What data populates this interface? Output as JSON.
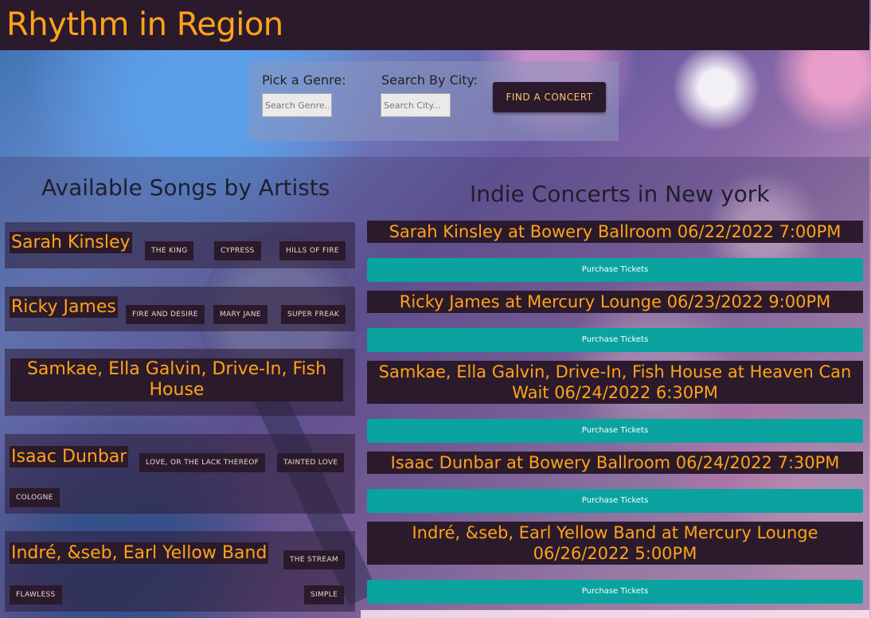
{
  "header": {
    "title": "Rhythm in Region"
  },
  "search": {
    "genre_label": "Pick a Genre:",
    "genre_placeholder": "Search Genre...",
    "city_label": "Search By City:",
    "city_placeholder": "Search City...",
    "find_button": "FIND A CONCERT"
  },
  "songs_section": {
    "title": "Available Songs by Artists",
    "artists": [
      {
        "name": "Sarah Kinsley",
        "songs": [
          "THE KING",
          "CYPRESS",
          "HILLS OF FIRE"
        ]
      },
      {
        "name": "Ricky James",
        "songs": [
          "FIRE AND DESIRE",
          "MARY JANE",
          "SUPER FREAK"
        ]
      },
      {
        "name": "Samkae, Ella Galvin, Drive-In, Fish House",
        "songs": []
      },
      {
        "name": "Isaac Dunbar",
        "songs": [
          "LOVE, OR THE LACK THEREOF",
          "TAINTED LOVE",
          "COLOGNE"
        ]
      },
      {
        "name": "Indré, &seb, Earl Yellow Band",
        "songs": [
          "THE STREAM",
          "FLAWLESS",
          "SIMPLE"
        ]
      }
    ]
  },
  "concerts_section": {
    "title": "Indie Concerts in New york",
    "concerts": [
      {
        "title": "Sarah Kinsley at Bowery Ballroom 06/22/2022 7:00PM",
        "button": "Purchase Tickets"
      },
      {
        "title": "Ricky James at Mercury Lounge 06/23/2022 9:00PM",
        "button": "Purchase Tickets"
      },
      {
        "title": "Samkae, Ella Galvin, Drive-In, Fish House at Heaven Can Wait 06/24/2022 6:30PM",
        "button": "Purchase Tickets"
      },
      {
        "title": "Isaac Dunbar at Bowery Ballroom 06/24/2022 7:30PM",
        "button": "Purchase Tickets"
      },
      {
        "title": "Indré, &seb, Earl Yellow Band at Mercury Lounge 06/26/2022 5:00PM",
        "button": "Purchase Tickets"
      }
    ]
  }
}
